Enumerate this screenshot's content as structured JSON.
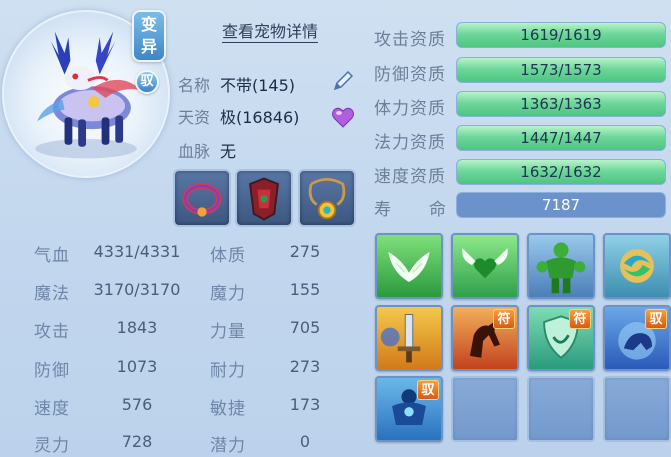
{
  "badges": {
    "mutation": "变异",
    "mutation_top": "变",
    "mutation_bottom": "异",
    "ride": "驭"
  },
  "detail_link": "查看宠物详情",
  "info": {
    "name_label": "名称",
    "name_value": "不带(145)",
    "talent_label": "天资",
    "talent_value": "极(16846)",
    "bloodline_label": "血脉",
    "bloodline_value": "无"
  },
  "equipment": [
    {
      "icon": "collar-equipment-icon"
    },
    {
      "icon": "armor-equipment-icon"
    },
    {
      "icon": "amulet-equipment-icon"
    }
  ],
  "stats_left": [
    {
      "label": "气血",
      "value": "4331/4331"
    },
    {
      "label": "魔法",
      "value": "3170/3170"
    },
    {
      "label": "攻击",
      "value": "1843"
    },
    {
      "label": "防御",
      "value": "1073"
    },
    {
      "label": "速度",
      "value": "576"
    },
    {
      "label": "灵力",
      "value": "728"
    }
  ],
  "stats_right": [
    {
      "label": "体质",
      "value": "275"
    },
    {
      "label": "魔力",
      "value": "155"
    },
    {
      "label": "力量",
      "value": "705"
    },
    {
      "label": "耐力",
      "value": "273"
    },
    {
      "label": "敏捷",
      "value": "173"
    },
    {
      "label": "潜力",
      "value": "0"
    }
  ],
  "aptitudes": [
    {
      "label": "攻击资质",
      "value": "1619/1619",
      "fill": 1.0
    },
    {
      "label": "防御资质",
      "value": "1573/1573",
      "fill": 1.0
    },
    {
      "label": "体力资质",
      "value": "1363/1363",
      "fill": 1.0
    },
    {
      "label": "法力资质",
      "value": "1447/1447",
      "fill": 1.0
    },
    {
      "label": "速度资质",
      "value": "1632/1632",
      "fill": 1.0
    }
  ],
  "lifespan": {
    "label_a": "寿",
    "label_b": "命",
    "value": "7187"
  },
  "skills": [
    {
      "icon": "white-wings-skill-icon",
      "tag": ""
    },
    {
      "icon": "green-heart-wings-skill-icon",
      "tag": ""
    },
    {
      "icon": "green-strongman-skill-icon",
      "tag": ""
    },
    {
      "icon": "swirl-orb-skill-icon",
      "tag": ""
    },
    {
      "icon": "sword-skill-icon",
      "tag": ""
    },
    {
      "icon": "horse-skill-icon",
      "tag": "符"
    },
    {
      "icon": "shield-skill-icon",
      "tag": "符"
    },
    {
      "icon": "blue-beast-skill-icon",
      "tag": "驭"
    },
    {
      "icon": "blue-golem-skill-icon",
      "tag": "驭"
    },
    {
      "icon": "empty-slot",
      "tag": ""
    },
    {
      "icon": "empty-slot",
      "tag": ""
    },
    {
      "icon": "empty-slot",
      "tag": ""
    }
  ],
  "colors": {
    "bar_fill": "#6fd79c",
    "bar_track": "#5d87c4",
    "background": "#c7daef"
  }
}
